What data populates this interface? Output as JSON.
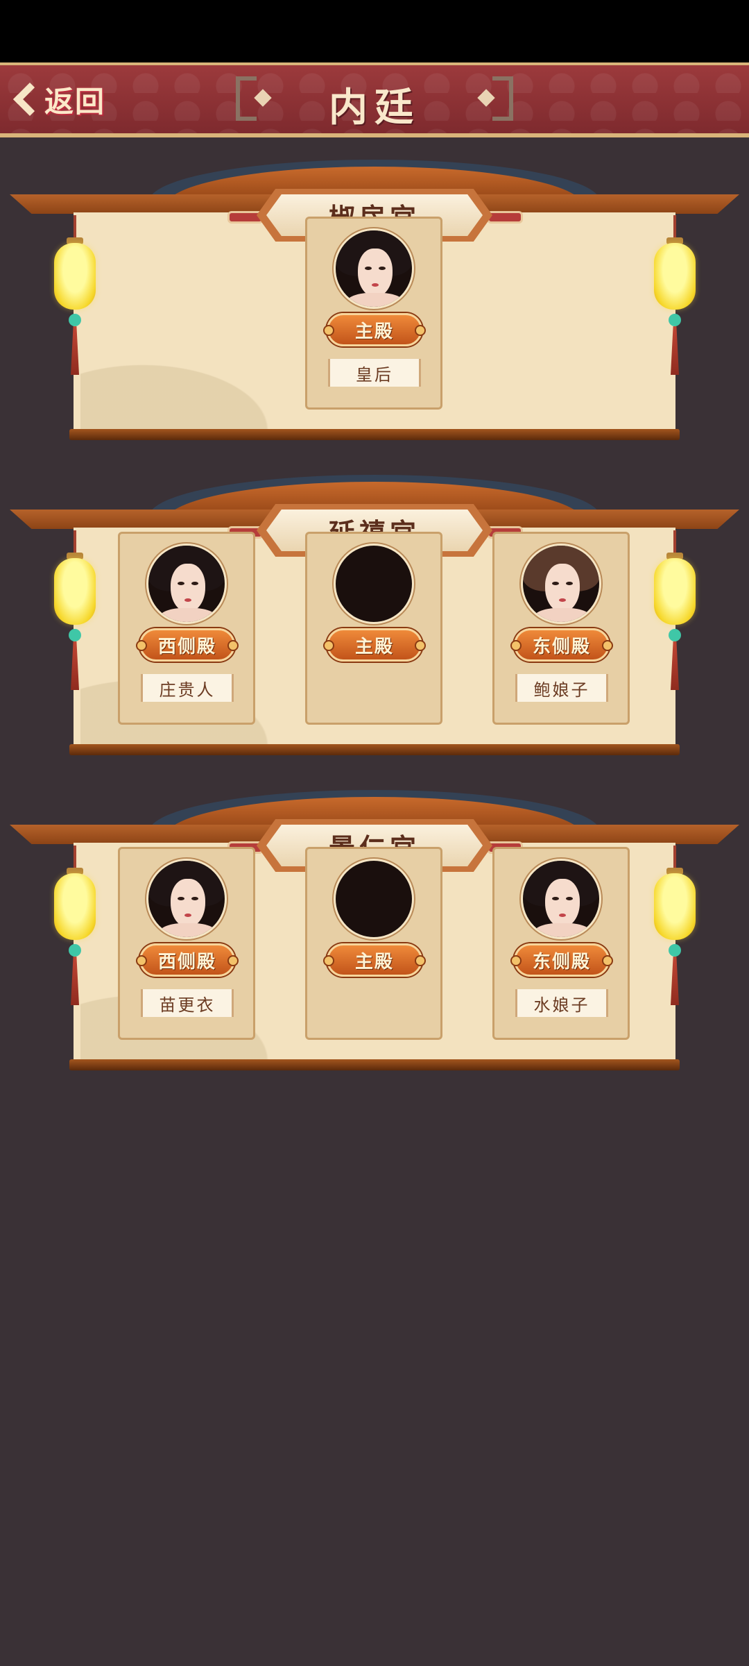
{
  "header": {
    "back_label": "返回",
    "title": "内廷"
  },
  "colors": {
    "background": "#3a3136",
    "header": "#8c3236",
    "panel": "#f3e2bf",
    "badge": "#d86a28"
  },
  "palaces": [
    {
      "name": "椒房宫",
      "slots": [
        null,
        {
          "role": "主殿",
          "resident": "皇后",
          "portrait": "empress-portrait",
          "occupied": true
        },
        null
      ]
    },
    {
      "name": "延禧宫",
      "slots": [
        {
          "role": "西侧殿",
          "resident": "庄贵人",
          "portrait": "consort-portrait",
          "occupied": true
        },
        {
          "role": "主殿",
          "resident": "",
          "portrait": "empty-portrait",
          "occupied": false
        },
        {
          "role": "东侧殿",
          "resident": "鲍娘子",
          "portrait": "consort-portrait",
          "occupied": true
        }
      ]
    },
    {
      "name": "景仁宫",
      "slots": [
        {
          "role": "西侧殿",
          "resident": "苗更衣",
          "portrait": "consort-portrait",
          "occupied": true
        },
        {
          "role": "主殿",
          "resident": "",
          "portrait": "empty-portrait",
          "occupied": false
        },
        {
          "role": "东侧殿",
          "resident": "水娘子",
          "portrait": "consort-portrait",
          "occupied": true
        }
      ]
    }
  ]
}
